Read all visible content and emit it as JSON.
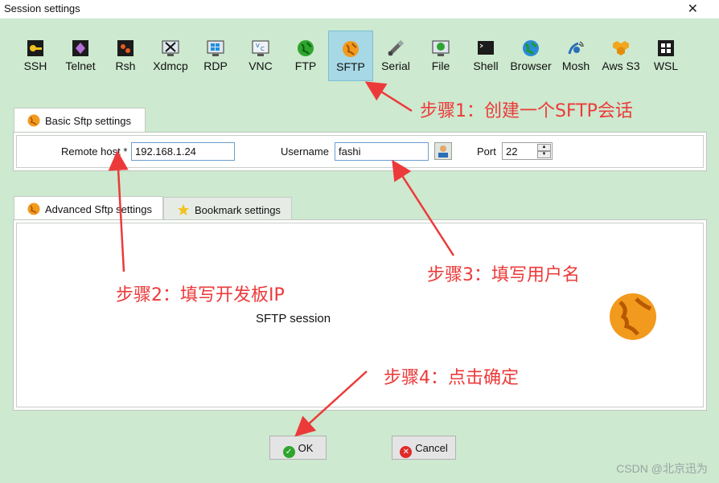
{
  "window": {
    "title": "Session settings",
    "close_glyph": "✕"
  },
  "session_types": [
    {
      "label": "SSH",
      "icon": "key-icon",
      "selected": false
    },
    {
      "label": "Telnet",
      "icon": "telnet-icon",
      "selected": false
    },
    {
      "label": "Rsh",
      "icon": "rsh-icon",
      "selected": false
    },
    {
      "label": "Xdmcp",
      "icon": "xdmcp-icon",
      "selected": false
    },
    {
      "label": "RDP",
      "icon": "rdp-icon",
      "selected": false
    },
    {
      "label": "VNC",
      "icon": "vnc-icon",
      "selected": false
    },
    {
      "label": "FTP",
      "icon": "ftp-icon",
      "selected": false
    },
    {
      "label": "SFTP",
      "icon": "sftp-icon",
      "selected": true
    },
    {
      "label": "Serial",
      "icon": "serial-icon",
      "selected": false
    },
    {
      "label": "File",
      "icon": "file-icon",
      "selected": false
    },
    {
      "label": "Shell",
      "icon": "shell-icon",
      "selected": false
    },
    {
      "label": "Browser",
      "icon": "browser-icon",
      "selected": false
    },
    {
      "label": "Mosh",
      "icon": "mosh-icon",
      "selected": false
    },
    {
      "label": "Aws S3",
      "icon": "aws-s3-icon",
      "selected": false
    },
    {
      "label": "WSL",
      "icon": "wsl-icon",
      "selected": false
    }
  ],
  "basic_tab": {
    "label": "Basic Sftp settings"
  },
  "basic": {
    "remote_host_label": "Remote host *",
    "remote_host_value": "192.168.1.24",
    "username_label": "Username",
    "username_value": "fashi",
    "port_label": "Port",
    "port_value": "22"
  },
  "lower_tabs": {
    "advanced": "Advanced Sftp settings",
    "bookmark": "Bookmark settings"
  },
  "session_caption": "SFTP session",
  "buttons": {
    "ok": "OK",
    "cancel": "Cancel"
  },
  "annotations": {
    "step1": "步骤1：创建一个SFTP会话",
    "step2": "步骤2：填写开发板IP",
    "step3": "步骤3：填写用户名",
    "step4": "步骤4：点击确定"
  },
  "watermark": "CSDN @北京迅为",
  "colors": {
    "background": "#cde9cf",
    "selected": "#a7d8e6",
    "annotation": "#ec3a3a",
    "sftp_orange": "#f29a1e"
  }
}
